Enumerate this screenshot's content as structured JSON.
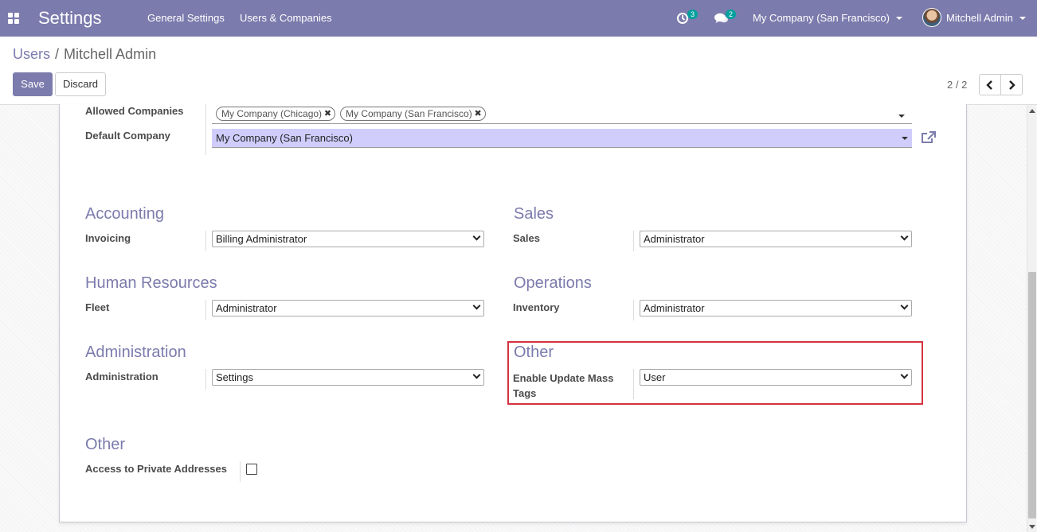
{
  "navbar": {
    "app_title": "Settings",
    "menu": [
      "General Settings",
      "Users & Companies"
    ],
    "activity_count": "3",
    "messages_count": "2",
    "company": "My Company (San Francisco)",
    "user": "Mitchell Admin",
    "color": "#7c7bad"
  },
  "breadcrumb": {
    "parent": "Users",
    "separator": "/",
    "current": "Mitchell Admin"
  },
  "buttons": {
    "save": "Save",
    "discard": "Discard"
  },
  "pager": {
    "value": "2 / 2"
  },
  "form": {
    "allowed_companies": {
      "label": "Allowed Companies",
      "tags": [
        "My Company (Chicago)",
        "My Company (San Francisco)"
      ]
    },
    "default_company": {
      "label": "Default Company",
      "value": "My Company (San Francisco)"
    },
    "groups": {
      "accounting": {
        "title": "Accounting",
        "label": "Invoicing",
        "value": "Billing Administrator"
      },
      "sales": {
        "title": "Sales",
        "label": "Sales",
        "value": "Administrator"
      },
      "human_resources": {
        "title": "Human Resources",
        "label": "Fleet",
        "value": "Administrator"
      },
      "operations": {
        "title": "Operations",
        "label": "Inventory",
        "value": "Administrator"
      },
      "administration": {
        "title": "Administration",
        "label": "Administration",
        "value": "Settings"
      },
      "other_right": {
        "title": "Other",
        "label_line1": "Enable Update Mass",
        "label_line2": "Tags",
        "value": "User"
      },
      "other_bottom": {
        "title": "Other",
        "label": "Access to Private Addresses",
        "checked": false
      }
    }
  },
  "colors": {
    "accent": "#7c7bad",
    "m2o_highlight": "#d0cdfc",
    "annotation_box": "#d3333e",
    "badge": "#00a09d"
  }
}
